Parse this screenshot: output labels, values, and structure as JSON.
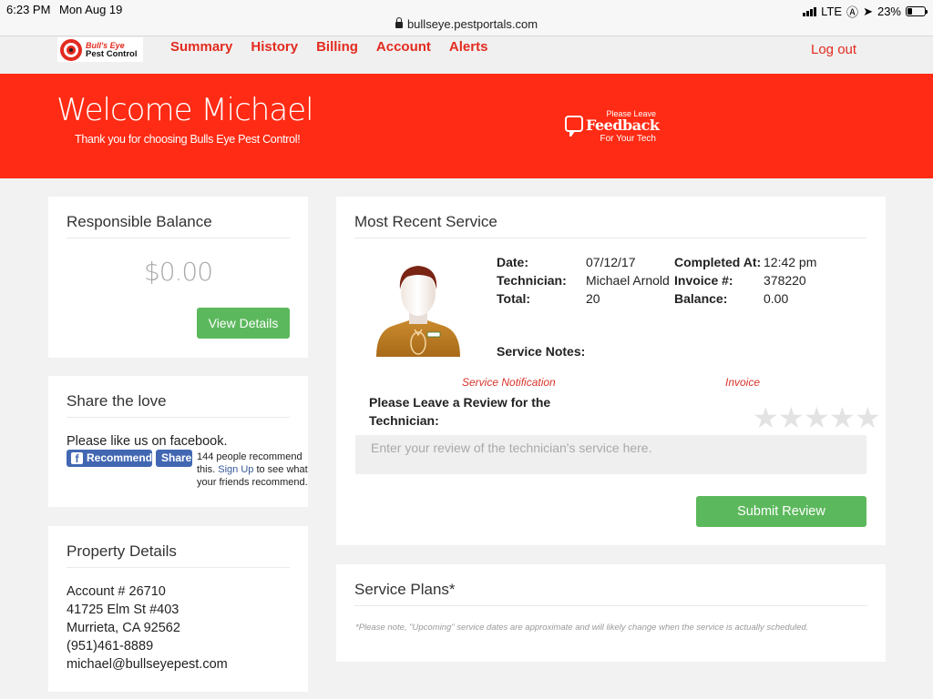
{
  "status_bar": {
    "time": "6:23 PM",
    "date": "Mon Aug 19",
    "network": "LTE",
    "battery": "23%",
    "url": "bullseye.pestportals.com"
  },
  "nav": {
    "logo_line1": "Bull's Eye",
    "logo_line2": "Pest Control",
    "links": [
      {
        "label": "Summary"
      },
      {
        "label": "History"
      },
      {
        "label": "Billing"
      },
      {
        "label": "Account"
      },
      {
        "label": "Alerts"
      }
    ],
    "logout": "Log out"
  },
  "hero": {
    "welcome": "Welcome Michael",
    "subtitle": "Thank you for choosing Bulls Eye Pest Control!",
    "feedback_top": "Please Leave",
    "feedback_main": "Feedback",
    "feedback_bottom": "For Your Tech"
  },
  "balance": {
    "title": "Responsible Balance",
    "amount": "$0.00",
    "button": "View Details"
  },
  "share": {
    "title": "Share the love",
    "prompt": "Please like us on facebook.",
    "recommend_button": "Recommend",
    "share_button": "Share",
    "count_text_pre": "144 people recommend this.",
    "signup_link": "Sign Up",
    "count_text_post": "to see what your friends recommend."
  },
  "property": {
    "title": "Property Details",
    "account": "Account # 26710",
    "address1": "41725 Elm St #403",
    "address2": "Murrieta, CA 92562",
    "phone": "(951)461-8889",
    "email": "michael@bullseyepest.com"
  },
  "service": {
    "title": "Most Recent Service",
    "fields": {
      "date_label": "Date:",
      "date": "07/12/17",
      "technician_label": "Technician:",
      "technician": "Michael Arnold",
      "total_label": "Total:",
      "total": "20",
      "completed_label": "Completed At:",
      "completed": "12:42 pm",
      "invoice_label": "Invoice #:",
      "invoice": "378220",
      "balance_label": "Balance:",
      "balance": "0.00"
    },
    "notes_label": "Service Notes:",
    "notification_link": "Service Notification",
    "invoice_link": "Invoice",
    "review_label": "Please Leave a Review for the Technician:",
    "rating": {
      "value": 0,
      "max": 5
    },
    "review_placeholder": "Enter your review of the technician's service here.",
    "review_value": "",
    "submit": "Submit Review"
  },
  "plans": {
    "title": "Service Plans*",
    "note": "*Please note, \"Upcoming\" service dates are approximate and will likely change when the service is actually scheduled."
  },
  "colors": {
    "brand_red": "#ff2b14",
    "link_red": "#e32b1f",
    "button_green": "#5cb85c",
    "facebook_blue": "#4267b2"
  }
}
